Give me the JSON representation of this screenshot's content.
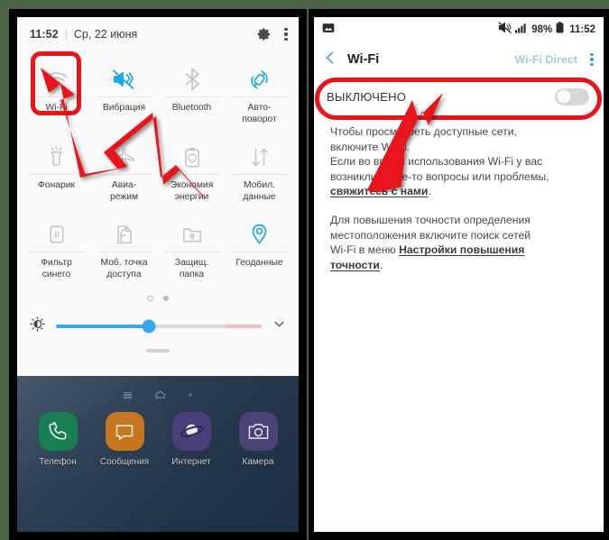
{
  "colors": {
    "accent_blue": "#19a8e8",
    "annotation_red": "#e8141a",
    "inactive_gray": "#c0c0c0",
    "frame_green": "#4a6348",
    "link_blue_faded": "#a3c9de"
  },
  "left_phone": {
    "quick_panel": {
      "status": {
        "time": "11:52",
        "separator": "|",
        "date": "Ср, 22 июня",
        "settings_icon": "gear-icon",
        "more_icon": "kebab-menu-icon"
      },
      "tiles": [
        {
          "label": "Wi-Fi",
          "icon": "wifi-icon",
          "active": false
        },
        {
          "label": "Вибрация",
          "icon": "vibrate-mute-icon",
          "active": true
        },
        {
          "label": "Bluetooth",
          "icon": "bluetooth-icon",
          "active": false
        },
        {
          "label": "Авто-\nповорот",
          "icon": "auto-rotate-icon",
          "active": true
        },
        {
          "label": "Фонарик",
          "icon": "flashlight-icon",
          "active": false
        },
        {
          "label": "Авиа-\nрежим",
          "icon": "airplane-icon",
          "active": false
        },
        {
          "label": "Экономия\nэнергии",
          "icon": "battery-saver-icon",
          "active": false
        },
        {
          "label": "Мобил.\nданные",
          "icon": "mobile-data-icon",
          "active": false
        },
        {
          "label": "Фильтр\nсинего",
          "icon": "blue-light-filter-icon",
          "active": false
        },
        {
          "label": "Моб. точка\nдоступа",
          "icon": "hotspot-icon",
          "active": false
        },
        {
          "label": "Защищ.\nпапка",
          "icon": "secure-folder-icon",
          "active": false
        },
        {
          "label": "Геоданные",
          "icon": "location-pin-icon",
          "active": true
        }
      ],
      "pager": {
        "pages": 2,
        "current": 2
      },
      "brightness": {
        "icon": "brightness-icon",
        "value_percent": 45,
        "expand_icon": "chevron-down-icon"
      }
    },
    "home_screen": {
      "nav": {
        "recents_icon": "recents-icon",
        "home_icon": "home-icon",
        "back_icon": "back-icon"
      },
      "dock": [
        {
          "label": "Телефон",
          "icon": "phone-icon",
          "bg": "#127a4e"
        },
        {
          "label": "Сообщения",
          "icon": "message-icon",
          "bg": "#c4741a"
        },
        {
          "label": "Интернет",
          "icon": "internet-icon",
          "bg": "#4a3f78"
        },
        {
          "label": "Камера",
          "icon": "camera-icon",
          "bg": "#4a4474"
        }
      ]
    }
  },
  "right_phone": {
    "status": {
      "screenshot_icon": "image-icon",
      "mute_icon": "mute-icon",
      "signal_icon": "signal-bars-icon",
      "battery_percent": "98%",
      "battery_icon": "battery-icon",
      "time": "11:52"
    },
    "appbar": {
      "back_icon": "back-chevron-icon",
      "title": "Wi-Fi",
      "action_label": "Wi-Fi Direct",
      "more_icon": "kebab-menu-icon"
    },
    "toggle": {
      "label": "ВЫКЛЮЧЕНО",
      "state": "off"
    },
    "body": {
      "paragraph1_line1": "Чтобы просмотреть доступные сети,",
      "paragraph1_line2": "включите Wi-Fi.",
      "paragraph2_line1": "Если во время использования Wi-Fi у вас",
      "paragraph2_line2": "возникли какие-то вопросы или проблемы,",
      "paragraph2_link": "свяжитесь с нами",
      "paragraph2_tail": ".",
      "paragraph3_line1": "Для повышения точности определения",
      "paragraph3_line2": "местоположения включите поиск сетей",
      "paragraph3_line3_pre": "Wi-Fi в меню ",
      "paragraph3_link_a": "Настройки повышения",
      "paragraph3_link_b": "точности",
      "paragraph3_tail": "."
    }
  },
  "annotations": {
    "highlight_wifi_tile": "red-rounded-rect",
    "highlight_wifi_switch": "red-rounded-rect",
    "arrow_to_wifi_tile": "red-arrow",
    "arrow_to_switch": "red-arrow"
  }
}
